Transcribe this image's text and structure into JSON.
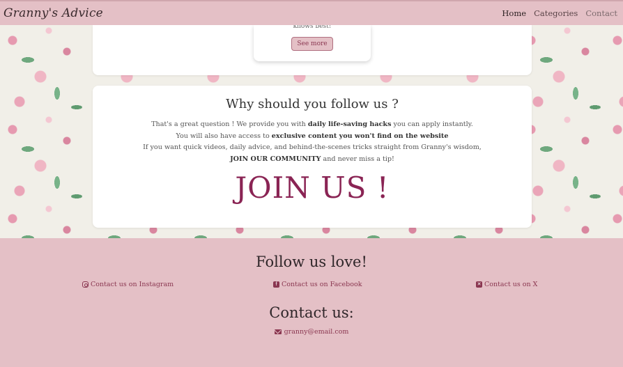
{
  "header": {
    "brand": "Granny's Advice",
    "nav": [
      {
        "label": "Home"
      },
      {
        "label": "Categories"
      },
      {
        "label": "Contact"
      }
    ]
  },
  "top_card": {
    "snippet": "knows best!",
    "button_label": "See more"
  },
  "follow_section": {
    "title": "Why should you follow us ?",
    "line1_pre": "That's a great question ! We provide you with ",
    "line1_bold": "daily life-saving hacks",
    "line1_post": " you can apply instantly.",
    "line2_pre": "You will also have access to ",
    "line2_bold": "exclusive content you won't find on the website",
    "line3": "If you want quick videos, daily advice, and behind-the-scenes tricks straight from Granny's wisdom,",
    "line4_bold": "JOIN OUR COMMUNITY",
    "line4_post": " and never miss a tip!",
    "cta": "JOIN US !"
  },
  "footer": {
    "follow_title": "Follow us love!",
    "socials": [
      {
        "label": "Contact us on Instagram",
        "icon": "instagram-icon"
      },
      {
        "label": "Contact us on Facebook",
        "icon": "facebook-icon"
      },
      {
        "label": "Contact us on X",
        "icon": "x-icon"
      }
    ],
    "contact_title": "Contact us:",
    "email": "granny@email.com"
  },
  "colors": {
    "accent": "#8a2454",
    "pink": "#e4c0c6"
  }
}
